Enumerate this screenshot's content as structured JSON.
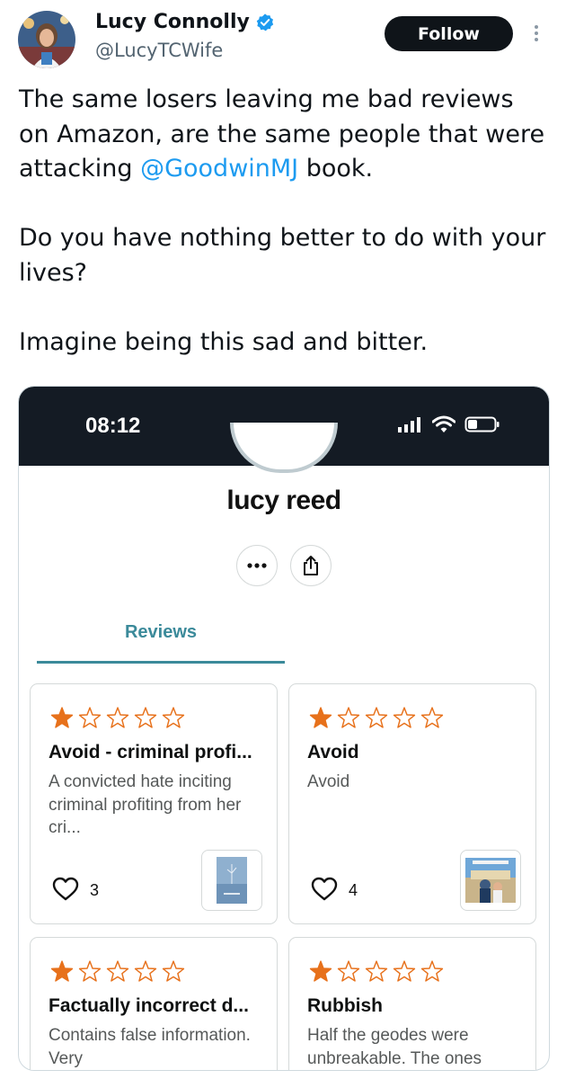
{
  "tweet": {
    "author_name": "Lucy Connolly",
    "author_handle": "@LucyTCWife",
    "follow_label": "Follow",
    "text_line1": "The same losers leaving me bad reviews",
    "text_line2": "on Amazon, are the same people that were",
    "text_line3_before": "attacking ",
    "mention": "@GoodwinMJ",
    "text_line3_after": " book.",
    "text_para2_line1": "Do you have nothing better to do with your",
    "text_para2_line2": "lives?",
    "text_para3": "Imagine being this sad and bitter."
  },
  "screenshot": {
    "time": "08:12",
    "profile_name": "lucy reed",
    "tab_reviews": "Reviews",
    "star_colors": {
      "filled": "#e7711b",
      "empty": "#e7711b"
    },
    "reviews": [
      {
        "rating": 1,
        "title": "Avoid - criminal profi...",
        "body": "A convicted hate inciting criminal profiting from her cri...",
        "likes": "3"
      },
      {
        "rating": 1,
        "title": "Avoid",
        "body": "Avoid",
        "likes": "4"
      },
      {
        "rating": 1,
        "title": "Factually incorrect d...",
        "body": "Contains false information. Very",
        "likes": ""
      },
      {
        "rating": 1,
        "title": "Rubbish",
        "body": "Half the geodes were unbreakable. The ones",
        "likes": ""
      }
    ]
  },
  "colors": {
    "accent": "#1d9bf0",
    "tab_accent": "#3b8a9a",
    "star": "#e7711b",
    "status_bar": "#141b24"
  }
}
